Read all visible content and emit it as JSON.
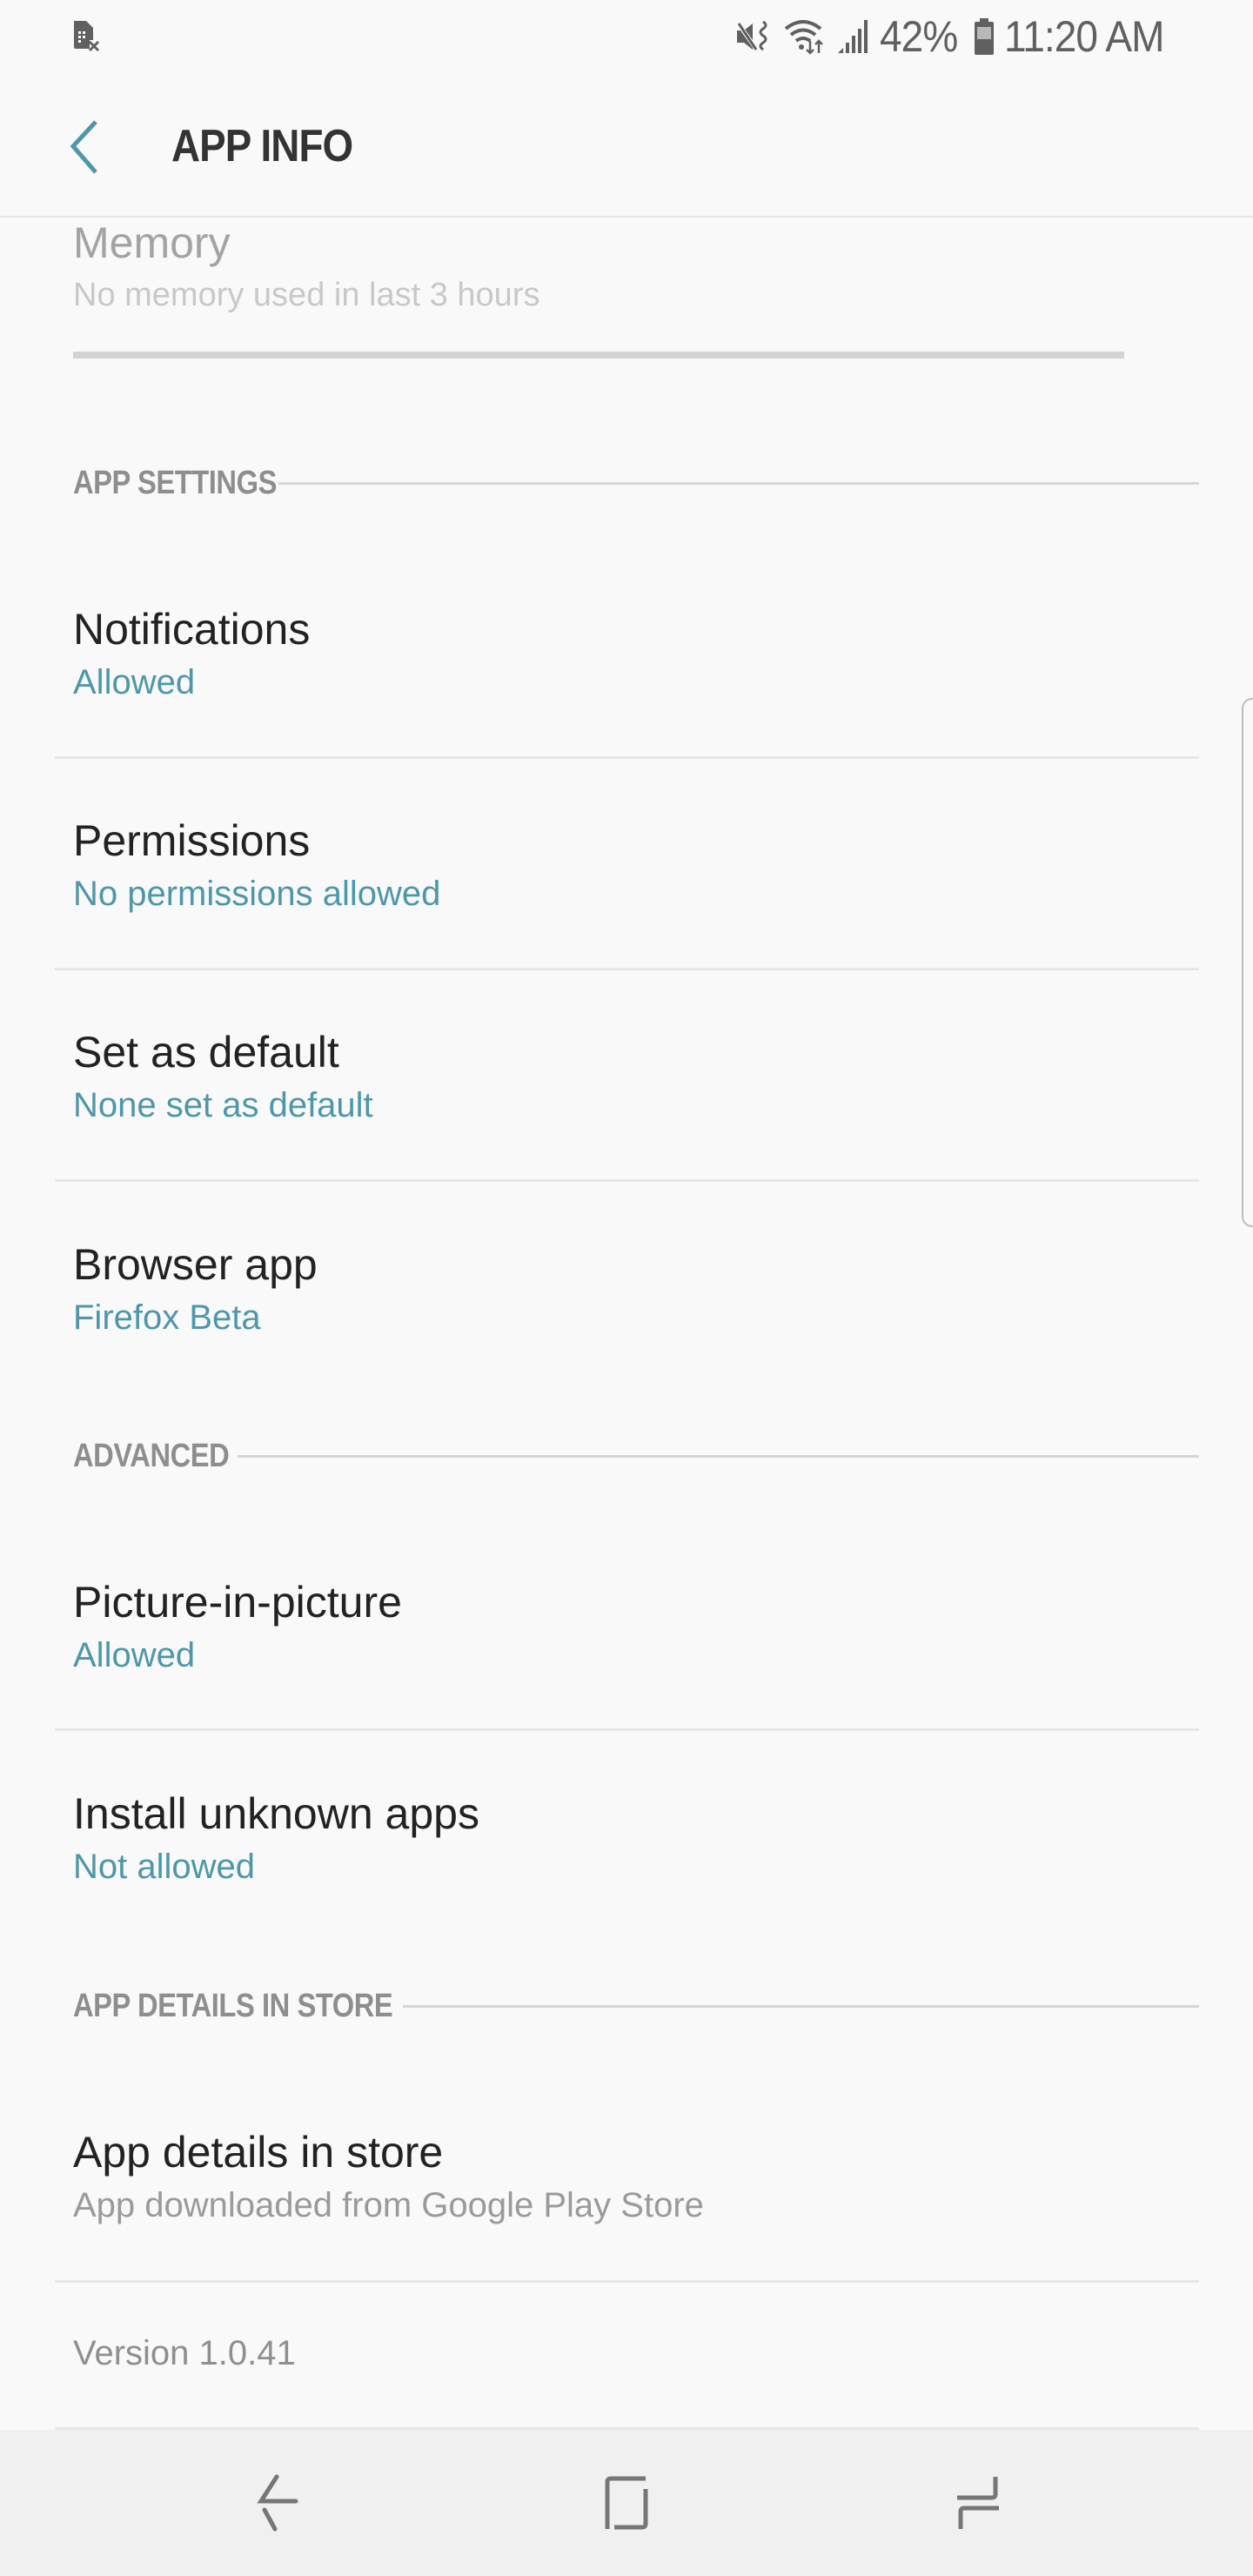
{
  "status_bar": {
    "left_icons": [
      "no-sim-icon"
    ],
    "right_icons": [
      "mute-vibrate-icon",
      "wifi-data-icon",
      "signal-icon"
    ],
    "battery_percent": "42%",
    "battery_icon": "battery-icon",
    "time": "11:20 AM"
  },
  "header": {
    "back_icon": "chevron-left-icon",
    "title": "APP INFO"
  },
  "memory": {
    "title": "Memory",
    "subtitle": "No memory used in last 3 hours",
    "usage_fraction": 0
  },
  "sections": [
    {
      "label": "APP SETTINGS",
      "items": [
        {
          "title": "Notifications",
          "subtitle": "Allowed"
        },
        {
          "title": "Permissions",
          "subtitle": "No permissions allowed"
        },
        {
          "title": "Set as default",
          "subtitle": "None set as default"
        },
        {
          "title": "Browser app",
          "subtitle": "Firefox Beta"
        }
      ]
    },
    {
      "label": "ADVANCED",
      "items": [
        {
          "title": "Picture-in-picture",
          "subtitle": "Allowed"
        },
        {
          "title": "Install unknown apps",
          "subtitle": "Not allowed"
        }
      ]
    },
    {
      "label": "APP DETAILS IN STORE",
      "items": [
        {
          "title": "App details in store",
          "subtitle": "App downloaded from Google Play Store"
        }
      ]
    }
  ],
  "footer": {
    "version": "Version 1.0.41"
  },
  "nav_bar": {
    "buttons": [
      "back-icon",
      "home-icon",
      "recents-icon"
    ]
  },
  "colors": {
    "accent": "#4e97aa",
    "title_text": "#222222",
    "section_label": "#8e8e8e",
    "background": "#f9f9f9",
    "nav_background": "#f0f0f0"
  }
}
